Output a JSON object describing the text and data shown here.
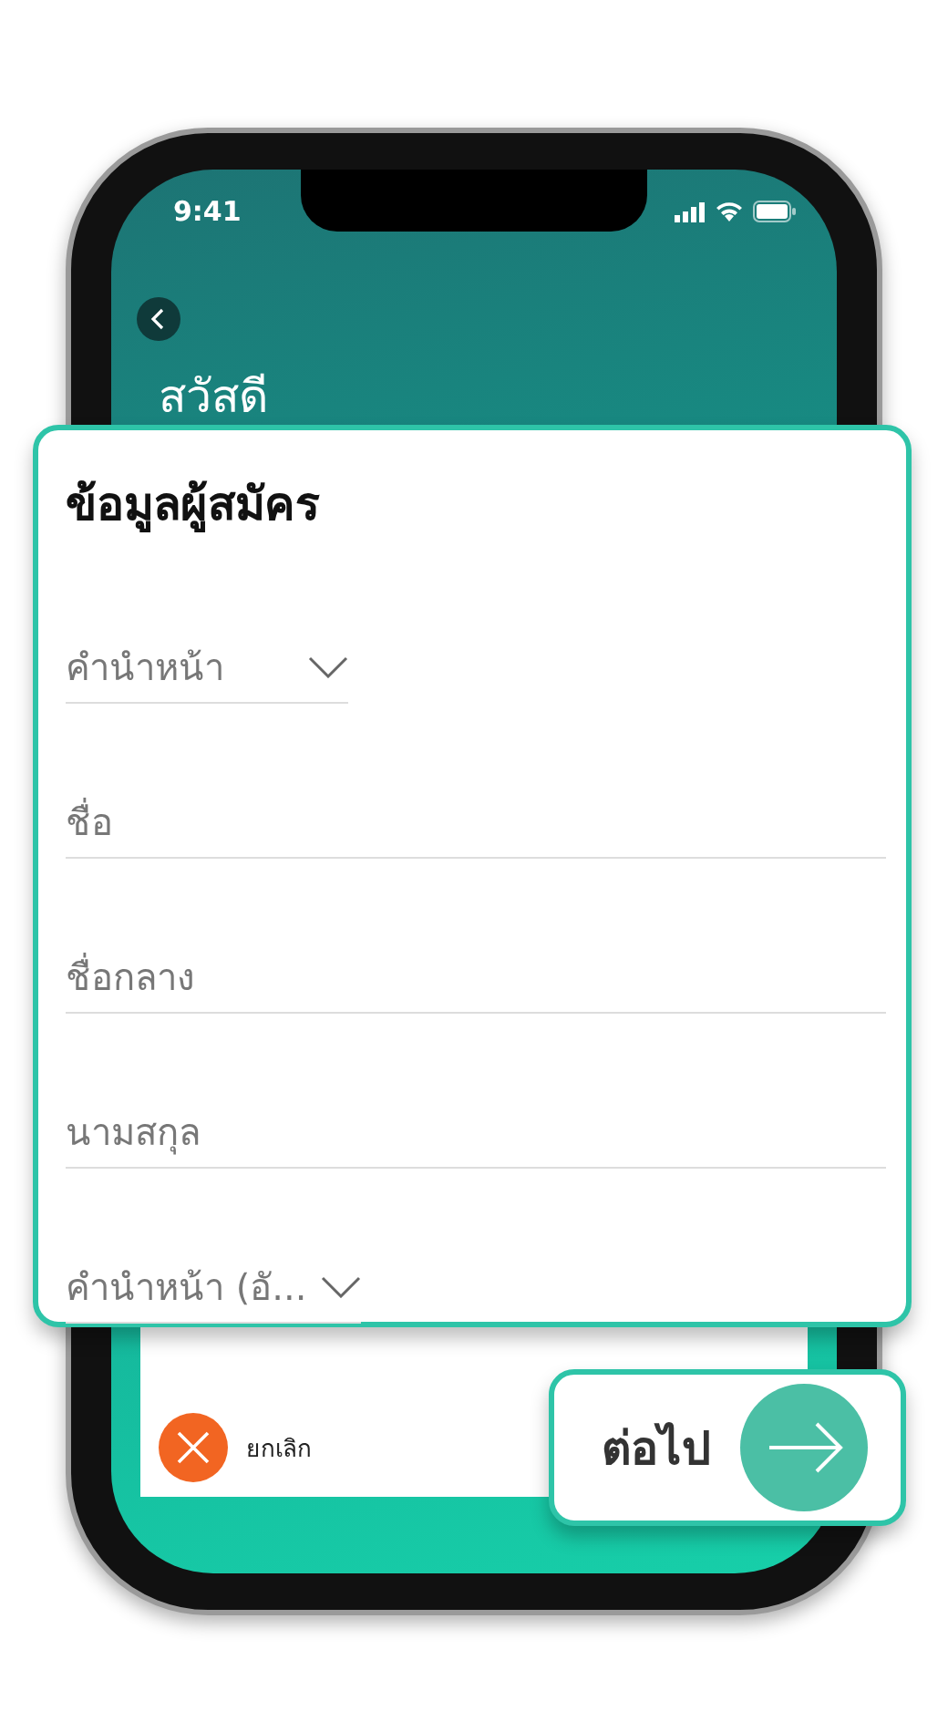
{
  "status_bar": {
    "time": "9:41"
  },
  "header": {
    "greeting": "สวัสดี"
  },
  "form": {
    "title": "ข้อมูลผู้สมัคร",
    "fields": [
      {
        "kind": "dropdown",
        "placeholder": "คำนำหน้า"
      },
      {
        "kind": "text",
        "placeholder": "ชื่อ"
      },
      {
        "kind": "text",
        "placeholder": "ชื่อกลาง"
      },
      {
        "kind": "text",
        "placeholder": "นามสกุล"
      },
      {
        "kind": "dropdown",
        "placeholder": "คำนำหน้า (อั..."
      }
    ]
  },
  "cancel_button": {
    "label": "ยกเลิก"
  },
  "next_button": {
    "label": "ต่อไป"
  }
}
